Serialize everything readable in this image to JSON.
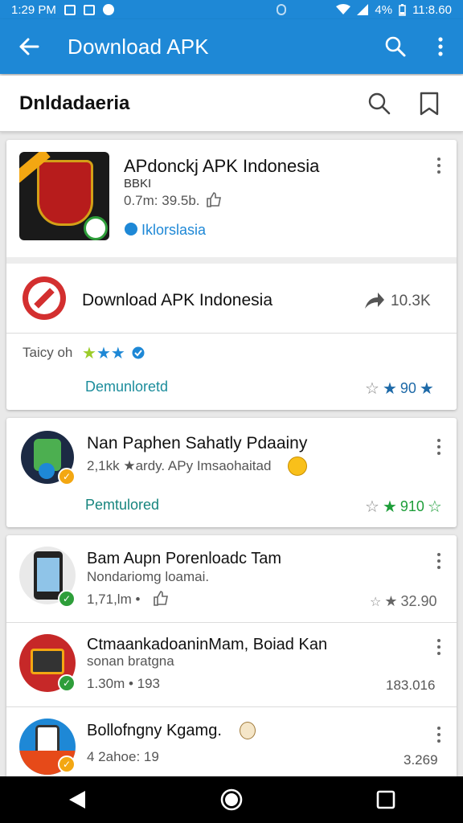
{
  "status_bar": {
    "time": "1:29 PM",
    "battery": "4%",
    "clock_right": "11:8.60"
  },
  "app_bar": {
    "title": "Download APK"
  },
  "search_bar": {
    "label": "Dnldadaeria"
  },
  "featured": {
    "app_title": "APdonckj APK Indonesia",
    "app_subtitle": "BBKI",
    "meta": "0.7m: 39.5b.",
    "publisher": "Iklorslasia",
    "row_title": "Download APK Indonesia",
    "row_count": "10.3K",
    "tagline": "Taicy oh",
    "action": "Demunloretd",
    "rating": "90"
  },
  "app2": {
    "title": "Nan Paphen Sahatly Pdaainy",
    "subtitle": "2,1kk ★ardy. APy Imsaohaitad",
    "action": "Pemtulored",
    "rating": "910"
  },
  "list": [
    {
      "title": "Bam Aupn Porenloadc Tam",
      "subtitle": "Nondariomg loamai.",
      "meta": "1,71,lm •",
      "right": "32.90"
    },
    {
      "title": "CtmaankadoaninMam, Boiad Kan",
      "subtitle": "sonan bratgna",
      "meta": "1.30m • 193",
      "right": "183.016"
    },
    {
      "title": "Bollofngny Kgamg.",
      "subtitle": "",
      "meta": "4 2ahoe: 19",
      "right": "3.269"
    }
  ],
  "colors": {
    "primary": "#1e88d6",
    "link": "#1c8d9c",
    "star_blue": "#1e6aa8",
    "star_green": "#1e9e3a"
  }
}
